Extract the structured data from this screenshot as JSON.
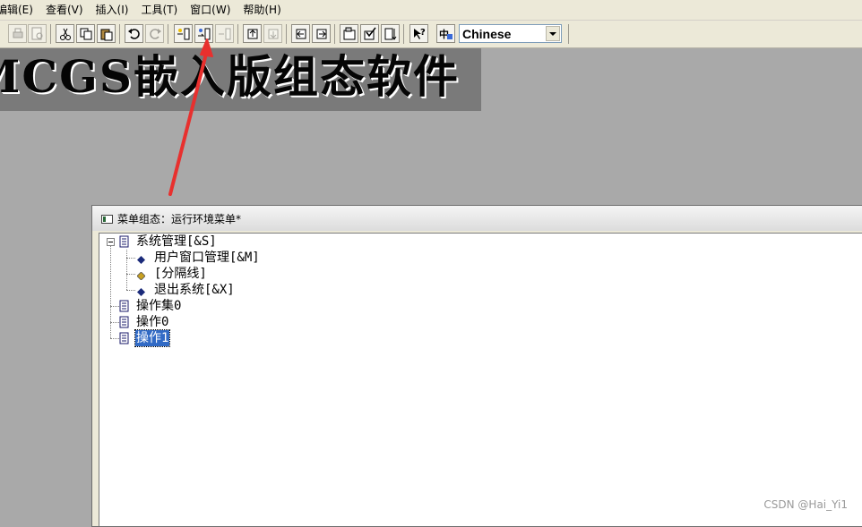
{
  "menubar": {
    "items": [
      {
        "label": "编辑(E)"
      },
      {
        "label": "查看(V)"
      },
      {
        "label": "插入(I)"
      },
      {
        "label": "工具(T)"
      },
      {
        "label": "窗口(W)"
      },
      {
        "label": "帮助(H)"
      }
    ]
  },
  "toolbar": {
    "language_select": {
      "value": "Chinese"
    }
  },
  "banner": {
    "text": "MCGS嵌入版组态软件"
  },
  "annotation": {
    "arrow_color": "#e8302e"
  },
  "window": {
    "title": "菜单组态：运行环境菜单*",
    "tree": {
      "root": {
        "label": "系统管理[&S]"
      },
      "children": [
        {
          "label": "用户窗口管理[&M]"
        },
        {
          "label": "[分隔线]"
        },
        {
          "label": "退出系统[&X]"
        }
      ],
      "siblings": [
        {
          "label": "操作集0"
        },
        {
          "label": "操作0"
        },
        {
          "label": "操作1",
          "selected": true
        }
      ]
    }
  },
  "watermark": "CSDN @Hai_Yi1",
  "colors": {
    "desktop": "#a9a9a9",
    "banner_bg": "#7a7a7a",
    "selection": "#316ac5"
  }
}
